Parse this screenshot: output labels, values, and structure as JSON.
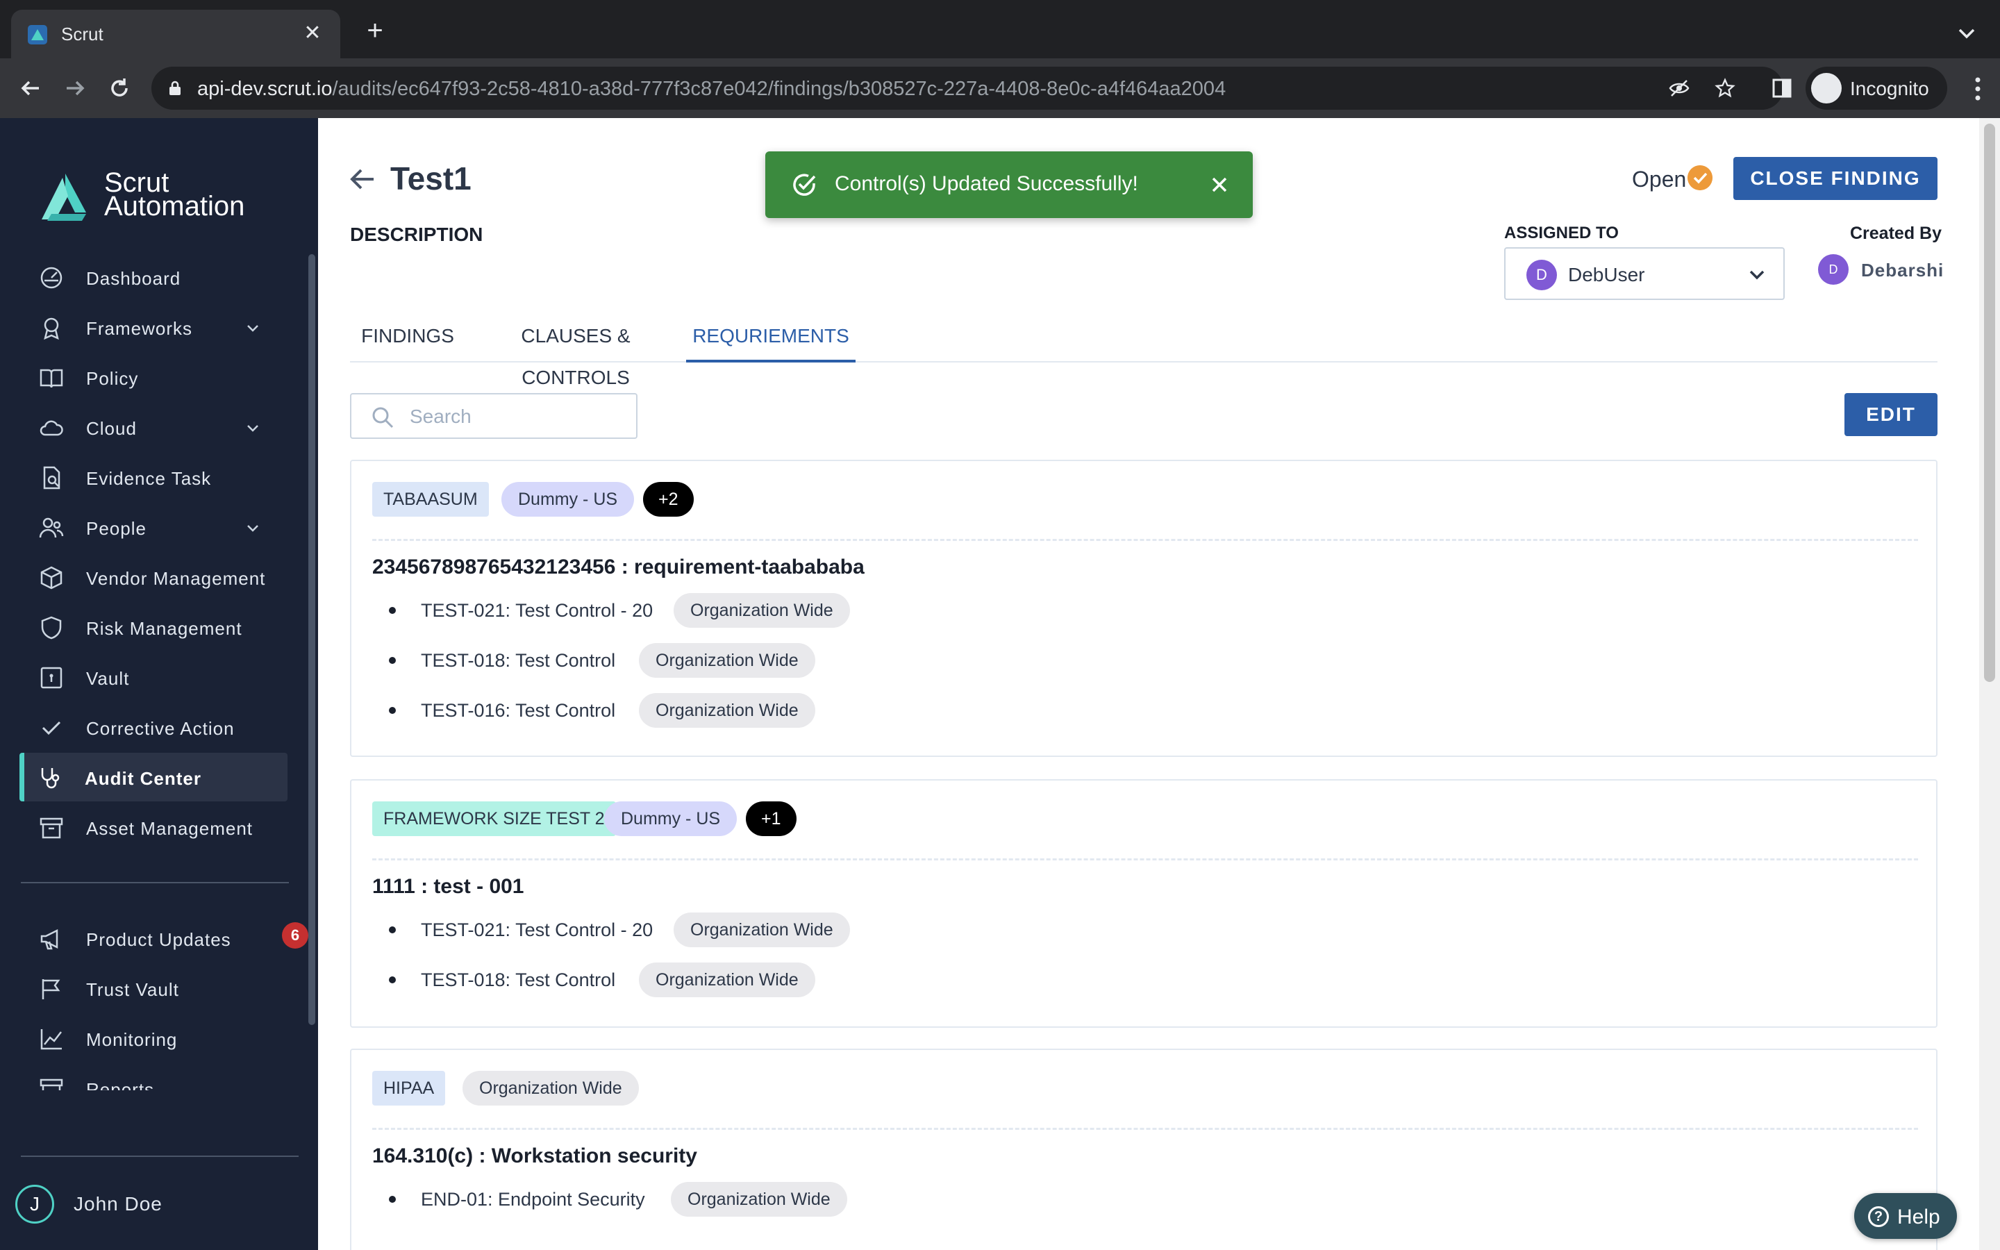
{
  "browser": {
    "tab_title": "Scrut",
    "url_host": "api-dev.scrut.io",
    "url_path": "/audits/ec647f93-2c58-4810-a38d-777f3c87e042/findings/b308527c-227a-4408-8e0c-a4f464aa2004",
    "incognito_label": "Incognito"
  },
  "sidebar": {
    "logo_line1": "Scrut",
    "logo_line2": "Automation",
    "items": [
      {
        "label": "Dashboard",
        "icon": "dashboard-icon"
      },
      {
        "label": "Frameworks",
        "icon": "frameworks-icon",
        "expandable": true
      },
      {
        "label": "Policy",
        "icon": "book-icon"
      },
      {
        "label": "Cloud",
        "icon": "cloud-icon",
        "expandable": true
      },
      {
        "label": "Evidence Task",
        "icon": "evidence-icon"
      },
      {
        "label": "People",
        "icon": "people-icon",
        "expandable": true
      },
      {
        "label": "Vendor Management",
        "icon": "box-icon"
      },
      {
        "label": "Risk Management",
        "icon": "shield-icon"
      },
      {
        "label": "Vault",
        "icon": "vault-icon"
      },
      {
        "label": "Corrective Action",
        "icon": "check-icon"
      },
      {
        "label": "Audit Center",
        "icon": "stethoscope-icon",
        "active": true
      },
      {
        "label": "Asset Management",
        "icon": "archive-icon"
      }
    ],
    "bottom_items": [
      {
        "label": "Product Updates",
        "icon": "megaphone-icon",
        "badge": "6"
      },
      {
        "label": "Trust Vault",
        "icon": "flag-icon"
      },
      {
        "label": "Monitoring",
        "icon": "chart-line-icon"
      },
      {
        "label": "Reports",
        "icon": "reports-icon"
      }
    ],
    "user": {
      "initial": "J",
      "name": "John Doe"
    }
  },
  "header": {
    "title": "Test1",
    "description_label": "DESCRIPTION",
    "status": "Open",
    "close_button": "CLOSE FINDING",
    "assigned_label": "ASSIGNED TO",
    "assigned_initial": "D",
    "assigned_name": "DebUser",
    "created_label": "Created By",
    "created_initial": "D",
    "created_name": "Debarshi"
  },
  "toast": {
    "message": "Control(s) Updated Successfully!"
  },
  "tabs": [
    {
      "label": "FINDINGS"
    },
    {
      "label": "CLAUSES & CONTROLS"
    },
    {
      "label": "REQURIEMENTS",
      "active": true
    }
  ],
  "search": {
    "placeholder": "Search",
    "value": ""
  },
  "edit_button": "EDIT",
  "requirements": [
    {
      "framework": "TABAASUM",
      "tags": [
        "Dummy - US"
      ],
      "more": "+2",
      "title": "234567898765432123456 : requirement-taabababa",
      "controls": [
        {
          "name": "TEST-021: Test Control - 20",
          "scope": "Organization Wide"
        },
        {
          "name": "TEST-018: Test Control",
          "scope": "Organization Wide"
        },
        {
          "name": "TEST-016: Test Control",
          "scope": "Organization Wide"
        }
      ]
    },
    {
      "framework": "FRAMEWORK SIZE TEST 2",
      "tags": [
        "Dummy - US"
      ],
      "more": "+1",
      "title": "1111 : test - 001",
      "controls": [
        {
          "name": "TEST-021: Test Control - 20",
          "scope": "Organization Wide"
        },
        {
          "name": "TEST-018: Test Control",
          "scope": "Organization Wide"
        }
      ]
    },
    {
      "framework": "HIPAA",
      "tags": [
        "Organization Wide"
      ],
      "more": "",
      "title": "164.310(c) : Workstation security",
      "controls": [
        {
          "name": "END-01: Endpoint Security",
          "scope": "Organization Wide"
        }
      ]
    }
  ],
  "help_label": "Help",
  "colors": {
    "accent": "#2c5ea8",
    "sidebar": "#1a2235",
    "toast": "#3b8a3e",
    "active_marker": "#4fd1c5"
  }
}
